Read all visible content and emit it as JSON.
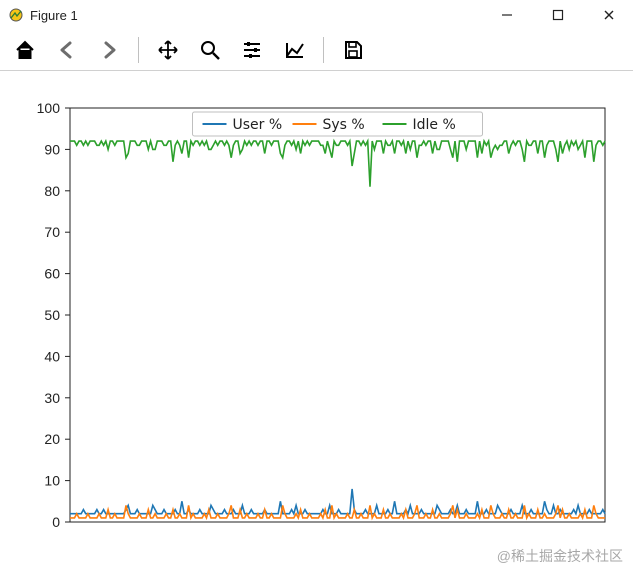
{
  "window": {
    "title": "Figure 1"
  },
  "watermark": "@稀土掘金技术社区",
  "colors": {
    "user": "#1f77b4",
    "sys": "#ff7f0e",
    "idle": "#2ca02c",
    "grid": "#b8b8b8",
    "axis": "#222222"
  },
  "chart_data": {
    "type": "line",
    "xlabel": "",
    "ylabel": "",
    "xlim": [
      0,
      240
    ],
    "ylim": [
      0,
      100
    ],
    "yticks": [
      0,
      10,
      20,
      30,
      40,
      50,
      60,
      70,
      80,
      90,
      100
    ],
    "legend": {
      "position": "top-center",
      "entries": [
        "User %",
        "Sys %",
        "Idle %"
      ]
    },
    "series": [
      {
        "name": "User %",
        "color_key": "user",
        "values": [
          2,
          2,
          2,
          2,
          2,
          2,
          3,
          2,
          2,
          2,
          2,
          2,
          3,
          2,
          2,
          3,
          2,
          2,
          2,
          2,
          2,
          2,
          2,
          2,
          2,
          3,
          4,
          2,
          2,
          2,
          3,
          2,
          2,
          2,
          2,
          2,
          2,
          4,
          3,
          2,
          2,
          2,
          3,
          2,
          2,
          2,
          2,
          3,
          2,
          2,
          5,
          2,
          2,
          3,
          2,
          2,
          2,
          2,
          3,
          2,
          2,
          2,
          2,
          4,
          3,
          2,
          2,
          2,
          2,
          3,
          2,
          2,
          2,
          3,
          2,
          2,
          2,
          4,
          2,
          2,
          2,
          3,
          2,
          2,
          2,
          2,
          2,
          3,
          2,
          2,
          2,
          2,
          2,
          2,
          5,
          2,
          2,
          2,
          2,
          3,
          2,
          4,
          2,
          2,
          2,
          3,
          2,
          2,
          2,
          2,
          2,
          2,
          2,
          3,
          2,
          2,
          4,
          2,
          2,
          2,
          3,
          2,
          2,
          2,
          2,
          2,
          8,
          3,
          2,
          2,
          2,
          2,
          3,
          2,
          2,
          2,
          2,
          4,
          2,
          2,
          2,
          2,
          3,
          2,
          2,
          5,
          2,
          2,
          2,
          2,
          3,
          2,
          4,
          2,
          2,
          2,
          2,
          3,
          2,
          2,
          2,
          2,
          2,
          2,
          4,
          3,
          2,
          2,
          2,
          2,
          3,
          2,
          2,
          4,
          2,
          2,
          2,
          3,
          2,
          2,
          2,
          2,
          5,
          2,
          2,
          2,
          3,
          2,
          2,
          2,
          2,
          4,
          3,
          2,
          2,
          2,
          2,
          3,
          2,
          2,
          2,
          2,
          4,
          2,
          2,
          2,
          3,
          2,
          2,
          2,
          2,
          2,
          5,
          3,
          2,
          2,
          4,
          2,
          2,
          3,
          2,
          2,
          2,
          2,
          2,
          3,
          2,
          4,
          2,
          2,
          2,
          2,
          3,
          2,
          2,
          2,
          2,
          2,
          3,
          2
        ]
      },
      {
        "name": "Sys %",
        "color_key": "sys",
        "values": [
          1,
          1,
          1,
          2,
          1,
          1,
          1,
          1,
          2,
          1,
          1,
          1,
          1,
          2,
          1,
          1,
          1,
          3,
          1,
          1,
          2,
          1,
          1,
          1,
          1,
          4,
          2,
          1,
          1,
          1,
          1,
          2,
          1,
          1,
          1,
          3,
          1,
          1,
          2,
          1,
          1,
          1,
          1,
          2,
          1,
          1,
          3,
          1,
          1,
          2,
          1,
          1,
          1,
          4,
          1,
          2,
          1,
          1,
          1,
          1,
          2,
          1,
          3,
          1,
          1,
          1,
          2,
          1,
          1,
          1,
          1,
          2,
          4,
          1,
          1,
          1,
          3,
          1,
          1,
          2,
          1,
          1,
          1,
          1,
          2,
          1,
          1,
          3,
          1,
          1,
          2,
          1,
          1,
          1,
          1,
          4,
          2,
          1,
          1,
          1,
          1,
          2,
          1,
          3,
          1,
          1,
          1,
          2,
          1,
          1,
          1,
          1,
          2,
          1,
          3,
          1,
          1,
          4,
          1,
          2,
          1,
          1,
          1,
          1,
          2,
          1,
          1,
          3,
          1,
          1,
          2,
          1,
          1,
          1,
          4,
          1,
          2,
          1,
          1,
          1,
          3,
          1,
          1,
          2,
          1,
          1,
          1,
          1,
          2,
          1,
          3,
          1,
          1,
          1,
          2,
          4,
          1,
          1,
          1,
          2,
          1,
          1,
          3,
          1,
          1,
          2,
          1,
          1,
          1,
          1,
          2,
          4,
          1,
          3,
          1,
          1,
          1,
          2,
          1,
          1,
          1,
          1,
          2,
          1,
          3,
          1,
          1,
          1,
          4,
          2,
          1,
          1,
          1,
          2,
          1,
          1,
          3,
          1,
          1,
          2,
          1,
          1,
          1,
          4,
          1,
          2,
          1,
          1,
          1,
          3,
          1,
          1,
          2,
          1,
          1,
          1,
          1,
          2,
          4,
          1,
          3,
          1,
          1,
          2,
          1,
          1,
          1,
          1,
          2,
          1,
          3,
          1,
          1,
          1,
          4,
          2,
          1,
          1,
          1,
          1
        ]
      },
      {
        "name": "Idle %",
        "color_key": "idle",
        "values": [
          92,
          92,
          92,
          91,
          92,
          92,
          91,
          92,
          91,
          92,
          92,
          92,
          91,
          91,
          92,
          91,
          92,
          90,
          92,
          92,
          91,
          92,
          92,
          92,
          92,
          88,
          89,
          92,
          92,
          92,
          91,
          91,
          92,
          92,
          92,
          90,
          92,
          90,
          90,
          92,
          92,
          92,
          91,
          91,
          92,
          92,
          87,
          91,
          92,
          91,
          89,
          92,
          92,
          88,
          92,
          91,
          92,
          92,
          91,
          92,
          91,
          92,
          90,
          90,
          91,
          92,
          91,
          92,
          92,
          91,
          92,
          91,
          88,
          91,
          92,
          92,
          89,
          90,
          92,
          91,
          92,
          91,
          92,
          92,
          91,
          92,
          92,
          89,
          92,
          92,
          91,
          92,
          92,
          92,
          89,
          88,
          91,
          92,
          92,
          91,
          92,
          90,
          92,
          89,
          92,
          91,
          92,
          91,
          92,
          92,
          92,
          92,
          91,
          91,
          89,
          92,
          90,
          88,
          92,
          91,
          91,
          92,
          92,
          92,
          91,
          92,
          86,
          89,
          92,
          92,
          91,
          92,
          91,
          92,
          81,
          92,
          90,
          92,
          92,
          92,
          89,
          92,
          91,
          91,
          92,
          89,
          92,
          92,
          91,
          92,
          89,
          92,
          90,
          92,
          92,
          88,
          91,
          91,
          92,
          91,
          92,
          92,
          89,
          92,
          90,
          90,
          92,
          92,
          92,
          92,
          90,
          88,
          92,
          87,
          92,
          92,
          92,
          90,
          92,
          92,
          92,
          92,
          88,
          92,
          89,
          92,
          91,
          92,
          88,
          90,
          91,
          90,
          91,
          91,
          92,
          92,
          89,
          91,
          92,
          91,
          92,
          92,
          90,
          87,
          92,
          91,
          91,
          92,
          92,
          89,
          92,
          92,
          88,
          91,
          92,
          92,
          92,
          90,
          87,
          92,
          89,
          91,
          92,
          90,
          92,
          91,
          92,
          90,
          91,
          92,
          88,
          92,
          92,
          92,
          87,
          91,
          92,
          92,
          91,
          92
        ]
      }
    ]
  }
}
